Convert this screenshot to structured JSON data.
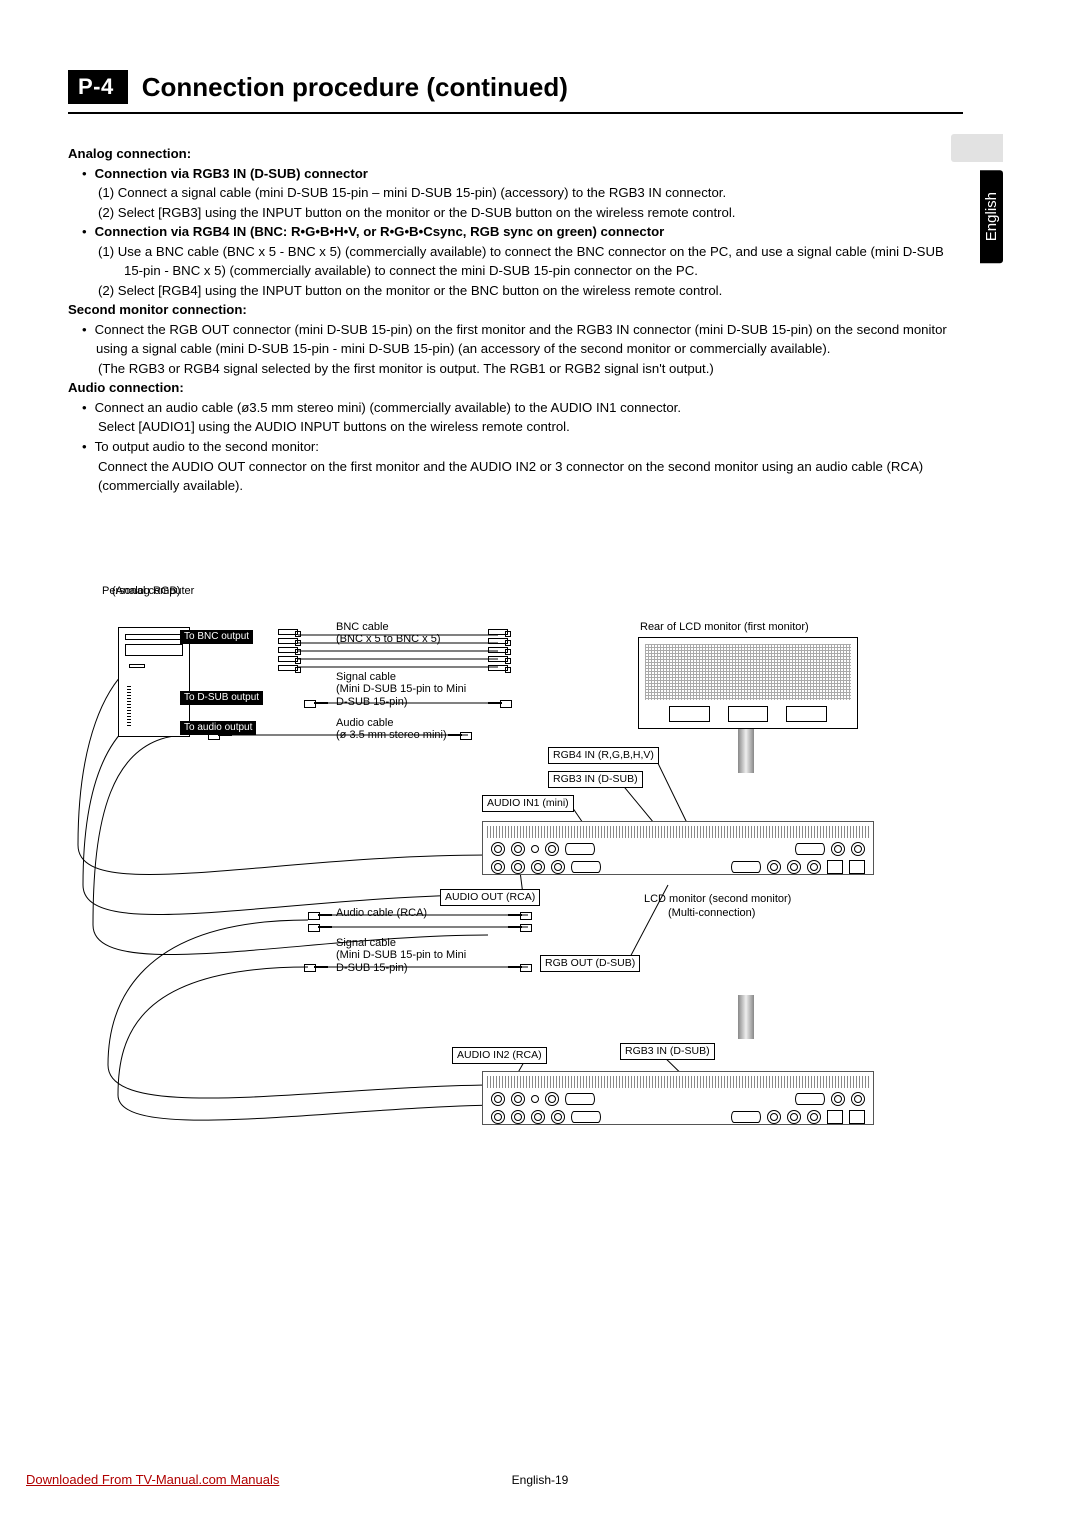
{
  "header": {
    "badge": "P-4",
    "title": "Connection procedure (continued)"
  },
  "lang_tab": "English",
  "body": {
    "analog_heading": "Analog connection:",
    "rgb3_heading": "Connection via RGB3 IN (D-SUB) connector",
    "rgb3_step1": "(1)  Connect a signal cable (mini D-SUB 15-pin – mini D-SUB 15-pin) (accessory) to the RGB3 IN connector.",
    "rgb3_step2": "(2)  Select [RGB3] using the INPUT button on the monitor or the D-SUB button on the wireless remote control.",
    "rgb4_heading": "Connection via RGB4 IN (BNC: R•G•B•H•V, or R•G•B•Csync, RGB sync on green) connector",
    "rgb4_step1": "(1)  Use a BNC cable (BNC x 5 - BNC x 5) (commercially available) to connect the BNC connector on the PC, and use a signal cable (mini D-SUB 15-pin - BNC x 5) (commercially available) to connect the mini D-SUB 15-pin connector on the PC.",
    "rgb4_step2": "(2)  Select [RGB4] using the INPUT button on the monitor or the BNC button on the wireless remote control.",
    "second_heading": "Second monitor connection:",
    "second_text": "Connect the RGB OUT connector (mini D-SUB 15-pin) on the first monitor and the RGB3 IN connector (mini D-SUB 15-pin) on the second monitor using a signal cable (mini D-SUB 15-pin - mini D-SUB 15-pin) (an accessory of the second monitor or commercially available).",
    "second_note": "(The RGB3 or RGB4 signal selected by the first monitor is output. The RGB1 or RGB2 signal isn't output.)",
    "audio_heading": "Audio connection:",
    "audio_b1": "Connect an audio cable (ø3.5 mm stereo mini) (commercially available) to the AUDIO IN1 connector.",
    "audio_b1b": "Select [AUDIO1] using the AUDIO INPUT buttons on the wireless remote control.",
    "audio_b2": "To output audio to the second monitor:",
    "audio_b2b": "Connect the AUDIO OUT connector on the first monitor and the AUDIO IN2 or 3 connector on the second monitor using an audio cable (RCA) (commercially available)."
  },
  "diagram": {
    "pc_title": "Personal computer",
    "pc_sub": "(Analog RGB)",
    "to_bnc": "To BNC output",
    "to_dsub": "To D-SUB output",
    "to_audio": "To audio output",
    "bnc_cable": "BNC cable",
    "bnc_cable_sub": "(BNC x 5 to BNC x 5)",
    "sig_cable": "Signal cable",
    "sig_cable_sub": "(Mini D-SUB 15-pin to Mini D-SUB 15-pin)",
    "audio_cable": "Audio cable",
    "audio_cable_sub": "(ø 3.5 mm stereo mini)",
    "rear_first": "Rear of LCD monitor (first monitor)",
    "rgb4_in": "RGB4 IN (R,G,B,H,V)",
    "rgb3_in": "RGB3 IN (D-SUB)",
    "audio_in1": "AUDIO IN1 (mini)",
    "audio_out": "AUDIO OUT (RCA)",
    "audio_cable_rca": "Audio cable (RCA)",
    "sig_cable2": "Signal cable",
    "sig_cable2_sub": "(Mini D-SUB 15-pin to Mini D-SUB 15-pin)",
    "rgb_out": "RGB OUT (D-SUB)",
    "second_mon": "LCD monitor (second monitor)",
    "second_mon_sub": "(Multi-connection)",
    "rgb3_in_2": "RGB3 IN (D-SUB)",
    "audio_in2": "AUDIO IN2 (RCA)"
  },
  "footer": {
    "left": "Downloaded From TV-Manual.com Manuals",
    "center": "English-19"
  }
}
